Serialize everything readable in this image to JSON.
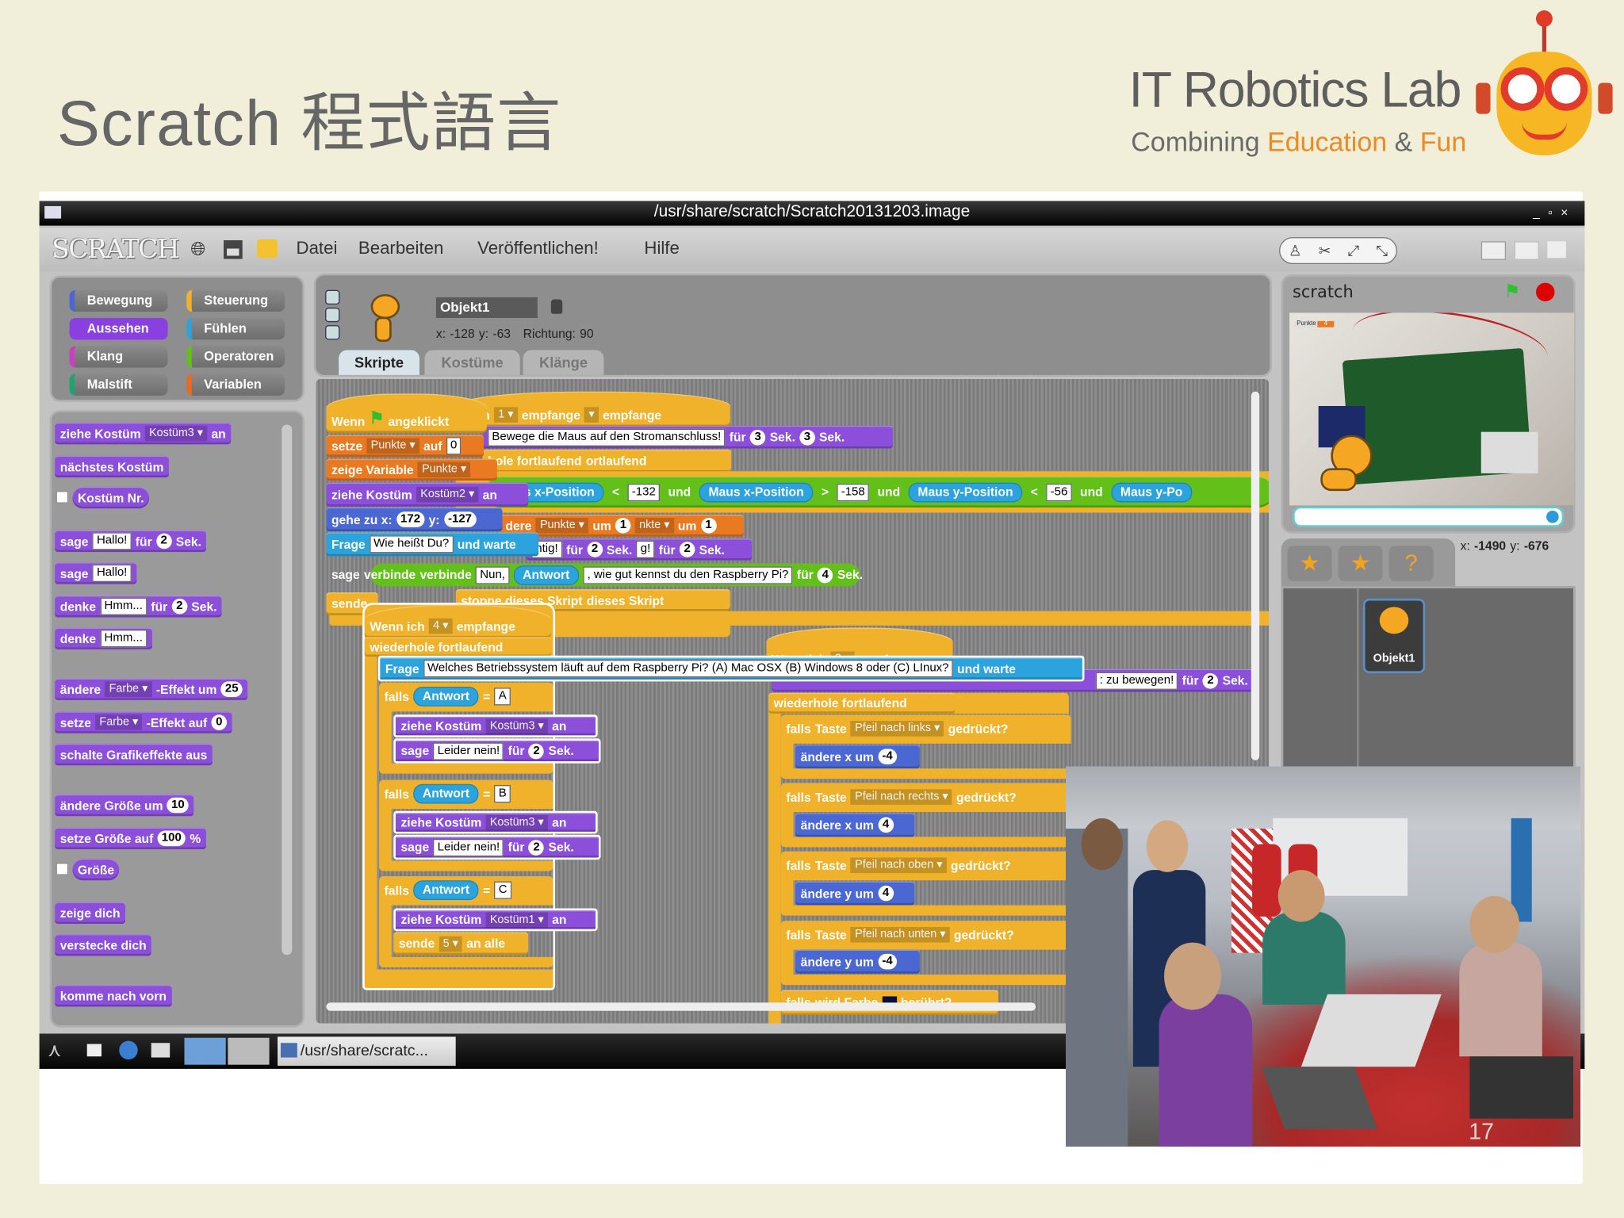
{
  "slide": {
    "title": "Scratch 程式語言",
    "page_number": "17"
  },
  "logo": {
    "main": "IT Robotics Lab",
    "sub_1": "Combining",
    "sub_2": "Education",
    "sub_3": "&",
    "sub_4": "Fun"
  },
  "window": {
    "title": "/usr/share/scratch/Scratch20131203.image",
    "controls": [
      "_",
      "▫",
      "×"
    ]
  },
  "menu": {
    "logo": "SCRATCH",
    "items": [
      "Datei",
      "Bearbeiten",
      "Veröffentlichen!",
      "Hilfe"
    ]
  },
  "categories": [
    "Bewegung",
    "Steuerung",
    "Aussehen",
    "Fühlen",
    "Klang",
    "Operatoren",
    "Malstift",
    "Variablen"
  ],
  "category_colors": [
    "#4a67d2",
    "#efb22a",
    "#8a3fe0",
    "#2ca3dc",
    "#c93fc0",
    "#62c019",
    "#1fa36f",
    "#ea6a22"
  ],
  "sprite": {
    "name": "Objekt1",
    "x_label": "x:",
    "x": "-128",
    "y_label": "y:",
    "y": "-63",
    "dir_label": "Richtung:",
    "dir": "90"
  },
  "tabs": [
    "Skripte",
    "Kostüme",
    "Klänge"
  ],
  "palette": [
    [
      {
        "t": "ziehe Kostüm"
      },
      {
        "dd": "Kostüm3"
      },
      {
        "t": "an"
      }
    ],
    [
      {
        "t": "nächstes Kostüm"
      }
    ],
    [
      {
        "t": "Kostüm Nr."
      }
    ],
    [
      {
        "t": "sage"
      },
      {
        "in": "Hallo!"
      },
      {
        "t": "für"
      },
      {
        "num": "2"
      },
      {
        "t": "Sek."
      }
    ],
    [
      {
        "t": "sage"
      },
      {
        "in": "Hallo!"
      }
    ],
    [
      {
        "t": "denke"
      },
      {
        "in": "Hmm..."
      },
      {
        "t": "für"
      },
      {
        "num": "2"
      },
      {
        "t": "Sek."
      }
    ],
    [
      {
        "t": "denke"
      },
      {
        "in": "Hmm..."
      }
    ],
    [
      {
        "t": "ändere"
      },
      {
        "dd": "Farbe"
      },
      {
        "t": "-Effekt um"
      },
      {
        "num": "25"
      }
    ],
    [
      {
        "t": "setze"
      },
      {
        "dd": "Farbe"
      },
      {
        "t": "-Effekt auf"
      },
      {
        "num": "0"
      }
    ],
    [
      {
        "t": "schalte Grafikeffekte aus"
      }
    ],
    [
      {
        "t": "ändere Größe um"
      },
      {
        "num": "10"
      }
    ],
    [
      {
        "t": "setze Größe auf"
      },
      {
        "num": "100"
      },
      {
        "t": "%"
      }
    ],
    [
      {
        "t": "Größe"
      }
    ],
    [
      {
        "t": "zeige dich"
      }
    ],
    [
      {
        "t": "verstecke dich"
      }
    ],
    [
      {
        "t": "komme nach vorn"
      }
    ]
  ],
  "script_back": [
    [
      {
        "t": "n ich"
      },
      {
        "dd": "1"
      },
      {
        "t": "empfange"
      },
      {
        "dd": ""
      },
      {
        "t": "empfange"
      }
    ],
    [
      {
        "in": "Bewege die Maus auf den Stromanschluss!"
      },
      {
        "t": "für"
      },
      {
        "num": "3"
      },
      {
        "t": "Sek."
      },
      {
        "num": "3"
      },
      {
        "t": "Sek."
      }
    ],
    [
      {
        "t": "hole fortlaufend"
      },
      {
        "t": "ortlaufend"
      }
    ],
    [
      {
        "rep": "Maus x-Position"
      },
      {
        "t": "<"
      },
      {
        "in": "-132"
      },
      {
        "t": "und"
      },
      {
        "rep": "Maus x-Position"
      },
      {
        "t": ">"
      },
      {
        "in": "-158"
      },
      {
        "t": "und"
      },
      {
        "rep": "Maus y-Position"
      },
      {
        "t": "<"
      },
      {
        "in": "-56"
      },
      {
        "t": "und"
      },
      {
        "rep": "Maus y-Po"
      }
    ],
    [
      {
        "t": "dere"
      },
      {
        "dd": "Punkte"
      },
      {
        "t": "um"
      },
      {
        "num": "1"
      },
      {
        "dd": "nkte"
      },
      {
        "t": "um"
      },
      {
        "num": "1"
      }
    ],
    [
      {
        "in": "htig!"
      },
      {
        "t": "für"
      },
      {
        "num": "2"
      },
      {
        "t": "Sek."
      },
      {
        "in": "g!"
      },
      {
        "t": "für"
      },
      {
        "num": "2"
      },
      {
        "t": "Sek."
      }
    ],
    [
      {
        "t": "stoppe dieses Skript"
      },
      {
        "t": "dieses Skript"
      }
    ]
  ],
  "script_main": [
    [
      {
        "t": "Wenn"
      },
      {
        "flag": "green-flag"
      },
      {
        "t": "angeklickt"
      }
    ],
    [
      {
        "t": "setze"
      },
      {
        "dd": "Punkte"
      },
      {
        "t": "auf"
      },
      {
        "in": "0"
      }
    ],
    [
      {
        "t": "zeige Variable"
      },
      {
        "dd": "Punkte"
      }
    ],
    [
      {
        "t": "ziehe Kostüm"
      },
      {
        "dd": "Kostüm2"
      },
      {
        "t": "an"
      }
    ],
    [
      {
        "t": "gehe zu x:"
      },
      {
        "num": "172"
      },
      {
        "t": "y:"
      },
      {
        "num": "-127"
      }
    ],
    [
      {
        "t": "Frage"
      },
      {
        "in": "Wie heißt Du?"
      },
      {
        "t": "und warte"
      }
    ],
    [
      {
        "t": "sage"
      },
      {
        "g": "verbinde"
      },
      {
        "g": "verbinde"
      },
      {
        "in": "Nun,"
      },
      {
        "rep": "Antwort"
      },
      {
        "in": ", wie gut kennst du den Raspberry Pi?"
      },
      {
        "t": "für"
      },
      {
        "num": "4"
      },
      {
        "t": "Sek."
      }
    ],
    [
      {
        "t": "sende"
      }
    ]
  ],
  "script_quiz": [
    [
      {
        "t": "Wenn ich"
      },
      {
        "dd": "4"
      },
      {
        "t": "empfange"
      }
    ],
    [
      {
        "t": "wiederhole fortlaufend"
      }
    ],
    [
      {
        "t": "Frage"
      },
      {
        "in": "Welches Betriebssystem läuft auf dem Raspberry Pi? (A) Mac OSX (B) Windows 8 oder (C) LInux?"
      },
      {
        "t": "und warte"
      }
    ],
    [
      {
        "t": "falls"
      },
      {
        "rep": "Antwort"
      },
      {
        "t": "="
      },
      {
        "in": "A"
      }
    ],
    [
      {
        "t": "ziehe Kostüm"
      },
      {
        "dd": "Kostüm3"
      },
      {
        "t": "an"
      }
    ],
    [
      {
        "t": "sage"
      },
      {
        "in": "Leider nein!"
      },
      {
        "t": "für"
      },
      {
        "num": "2"
      },
      {
        "t": "Sek."
      }
    ],
    [
      {
        "t": "falls"
      },
      {
        "rep": "Antwort"
      },
      {
        "t": "="
      },
      {
        "in": "B"
      }
    ],
    [
      {
        "t": "ziehe Kostüm"
      },
      {
        "dd": "Kostüm3"
      },
      {
        "t": "an"
      }
    ],
    [
      {
        "t": "sage"
      },
      {
        "in": "Leider nein!"
      },
      {
        "t": "für"
      },
      {
        "num": "2"
      },
      {
        "t": "Sek."
      }
    ],
    [
      {
        "t": "falls"
      },
      {
        "rep": "Antwort"
      },
      {
        "t": "="
      },
      {
        "in": "C"
      }
    ],
    [
      {
        "t": "ziehe Kostüm"
      },
      {
        "dd": "Kostüm1"
      },
      {
        "t": "an"
      }
    ],
    [
      {
        "t": "sende"
      },
      {
        "dd": "5"
      },
      {
        "t": "an alle"
      }
    ]
  ],
  "script_keys": [
    [
      {
        "t": "Wenn ich"
      },
      {
        "dd": "3"
      },
      {
        "t": "empfange"
      }
    ],
    [
      {
        "in": ": zu bewegen!"
      },
      {
        "t": "für"
      },
      {
        "num": "2"
      },
      {
        "t": "Sek."
      }
    ],
    [
      {
        "t": "wiederhole fortlaufend"
      }
    ],
    [
      {
        "t": "falls"
      },
      {
        "t": "Taste"
      },
      {
        "dd": "Pfeil nach links"
      },
      {
        "t": "gedrückt?"
      }
    ],
    [
      {
        "t": "ändere x um"
      },
      {
        "num": "-4"
      }
    ],
    [
      {
        "t": "falls"
      },
      {
        "t": "Taste"
      },
      {
        "dd": "Pfeil nach rechts"
      },
      {
        "t": "gedrückt?"
      }
    ],
    [
      {
        "t": "ändere x um"
      },
      {
        "num": "4"
      }
    ],
    [
      {
        "t": "falls"
      },
      {
        "t": "Taste"
      },
      {
        "dd": "Pfeil nach oben"
      },
      {
        "t": "gedrückt?"
      }
    ],
    [
      {
        "t": "ändere y um"
      },
      {
        "num": "4"
      }
    ],
    [
      {
        "t": "falls"
      },
      {
        "t": "Taste"
      },
      {
        "dd": "Pfeil nach unten"
      },
      {
        "t": "gedrückt?"
      }
    ],
    [
      {
        "t": "ändere y um"
      },
      {
        "num": "-4"
      }
    ],
    [
      {
        "t": "falls"
      },
      {
        "t": "wird Farbe"
      },
      {
        "sw": "color"
      },
      {
        "t": "berührt?"
      }
    ]
  ],
  "stage": {
    "title": "scratch",
    "monitor_label": "Punkte",
    "monitor_value": "4",
    "mouse_x_label": "x:",
    "mouse_x": "-1490",
    "mouse_y_label": "y:",
    "mouse_y": "-676"
  },
  "sprite_list": {
    "items": [
      "Objekt1"
    ]
  },
  "taskbar": {
    "window_label": "/usr/share/scratc..."
  }
}
